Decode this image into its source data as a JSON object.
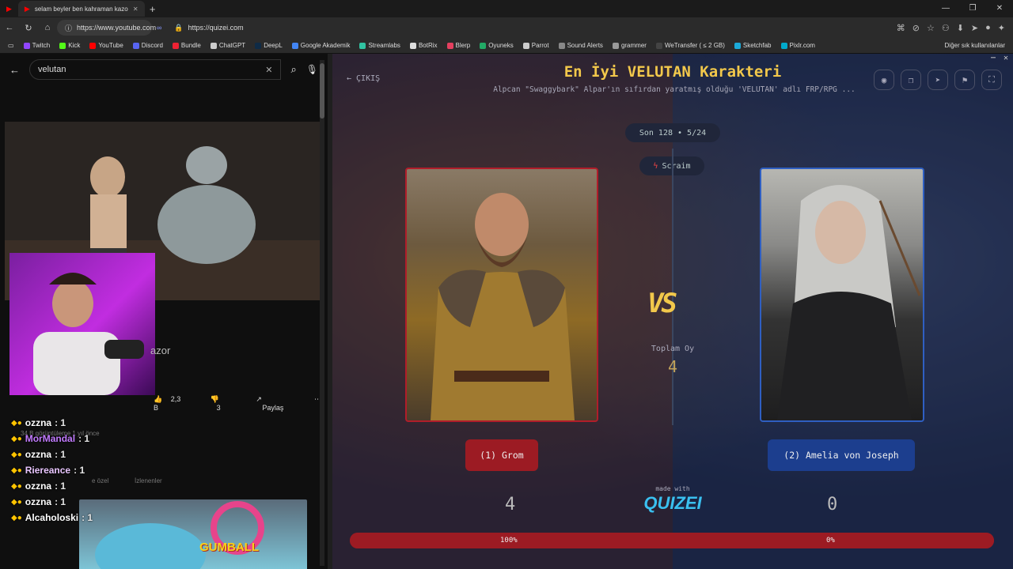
{
  "browser": {
    "tab_title": "selam beyler ben kahraman kazor",
    "url": "https://www.youtube.com",
    "url2": "https://quizei.com",
    "window": {
      "min": "—",
      "max": "❐",
      "close": "✕"
    },
    "bookmarks": [
      {
        "label": "Twitch",
        "color": "#9146ff"
      },
      {
        "label": "Kick",
        "color": "#53fc18"
      },
      {
        "label": "YouTube",
        "color": "#ff0000"
      },
      {
        "label": "Discord",
        "color": "#5865f2"
      },
      {
        "label": "Bundle",
        "color": "#e23"
      },
      {
        "label": "ChatGPT",
        "color": "#ccc"
      },
      {
        "label": "DeepL",
        "color": "#0f2b46"
      },
      {
        "label": "Google Akademik",
        "color": "#4285f4"
      },
      {
        "label": "Streamlabs",
        "color": "#31c3a2"
      },
      {
        "label": "BotRix",
        "color": "#ddd"
      },
      {
        "label": "Blerp",
        "color": "#e4405f"
      },
      {
        "label": "Oyuneks",
        "color": "#2a6"
      },
      {
        "label": "Parrot",
        "color": "#ccc"
      },
      {
        "label": "Sound Alerts",
        "color": "#888"
      },
      {
        "label": "grammer",
        "color": "#999"
      },
      {
        "label": "WeTransfer ( ≤ 2 GB)",
        "color": "#444"
      },
      {
        "label": "Sketchfab",
        "color": "#1caad9"
      },
      {
        "label": "Pixlr.com",
        "color": "#0ac"
      }
    ],
    "other_bookmarks": "Diğer sık kullanılanlar"
  },
  "youtube": {
    "search_value": "velutan",
    "channel_fragment": "azor",
    "likes": "2,3 B",
    "dislikes": "3",
    "share": "Paylaş",
    "views": "34 B görüntüleme  1 yıl önce",
    "ghost1": "e özel",
    "ghost2": "İzlenenler",
    "chat": [
      {
        "user": "ozzna",
        "msg": ": 1",
        "color": "#ffffff"
      },
      {
        "user": "MorMandal",
        "msg": ": 1",
        "color": "#c27bff"
      },
      {
        "user": "ozzna",
        "msg": ": 1",
        "color": "#ffffff"
      },
      {
        "user": "Riereance",
        "msg": ": 1",
        "color": "#e9c6ff"
      },
      {
        "user": "ozzna",
        "msg": ": 1",
        "color": "#ffffff"
      },
      {
        "user": "ozzna",
        "msg": ": 1",
        "color": "#ffffff"
      },
      {
        "user": "Alcaholoski",
        "msg": ": 1",
        "color": "#ffffff"
      }
    ],
    "gumball_logo": "GUMBALL"
  },
  "quizei": {
    "exit": "ÇIKIŞ",
    "title": "En İyi VELUTAN Karakteri",
    "subtitle": "Alpcan \"Swaggybark\" Alpar'ın sıfırdan yaratmış olduğu 'VELUTAN' adlı FRP/RPG ...",
    "round": "Son 128 • 5/24",
    "mode": "Scraim",
    "vs": "VS",
    "total_label": "Toplam Oy",
    "total_value": "4",
    "left": {
      "button": "(1) Grom",
      "score": "4",
      "percent": "100%"
    },
    "right": {
      "button": "(2) Amelia von Joseph",
      "score": "0",
      "percent": "0%"
    },
    "made_with": "made with",
    "logo": "QUIZEI",
    "progress_left": 1.0,
    "accent": "#f2c84b",
    "red": "#9c1b23",
    "blue": "#1c3e8e"
  }
}
